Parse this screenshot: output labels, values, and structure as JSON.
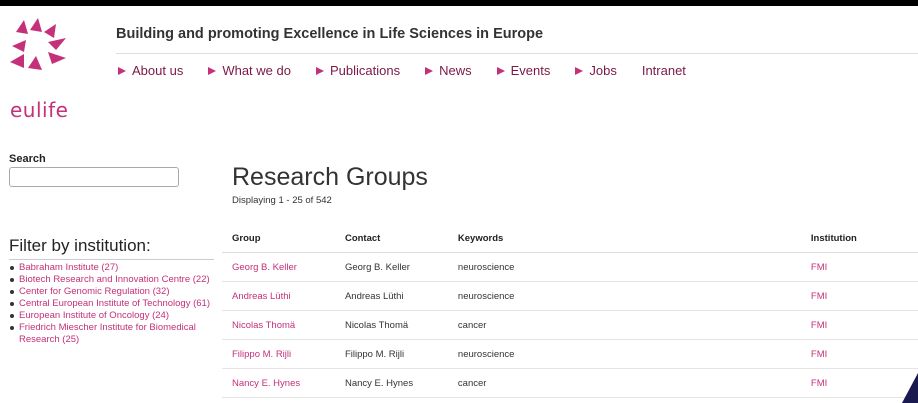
{
  "brand": {
    "name": "eulife",
    "tagline": "Building and promoting Excellence in Life Sciences in Europe",
    "accent": "#c4307a"
  },
  "nav": [
    {
      "label": "About us",
      "arrow": true
    },
    {
      "label": "What we do",
      "arrow": true
    },
    {
      "label": "Publications",
      "arrow": true
    },
    {
      "label": "News",
      "arrow": true
    },
    {
      "label": "Events",
      "arrow": true
    },
    {
      "label": "Jobs",
      "arrow": true
    },
    {
      "label": "Intranet",
      "arrow": false
    }
  ],
  "sidebar": {
    "search_label": "Search",
    "search_value": "",
    "filter_title": "Filter by institution:",
    "institutions": [
      "Babraham Institute (27)",
      "Biotech Research and Innovation Centre (22)",
      "Center for Genomic Regulation (32)",
      "Central European Institute of Technology (61)",
      "European Institute of Oncology (24)",
      "Friedrich Miescher Institute for Biomedical Research (25)"
    ]
  },
  "main": {
    "title": "Research Groups",
    "display_count": "Displaying 1 - 25 of 542",
    "columns": [
      "Group",
      "Contact",
      "Keywords",
      "Institution"
    ],
    "rows": [
      {
        "group": "Georg B. Keller",
        "contact": "Georg B. Keller",
        "keywords": "neuroscience",
        "institution": "FMI"
      },
      {
        "group": "Andreas Lüthi",
        "contact": "Andreas Lüthi",
        "keywords": "neuroscience",
        "institution": "FMI"
      },
      {
        "group": "Nicolas Thomä",
        "contact": "Nicolas Thomä",
        "keywords": "cancer",
        "institution": "FMI"
      },
      {
        "group": "Filippo M. Rijli",
        "contact": "Filippo M. Rijli",
        "keywords": "neuroscience",
        "institution": "FMI"
      },
      {
        "group": "Nancy E. Hynes",
        "contact": "Nancy E. Hynes",
        "keywords": "cancer",
        "institution": "FMI"
      }
    ]
  }
}
